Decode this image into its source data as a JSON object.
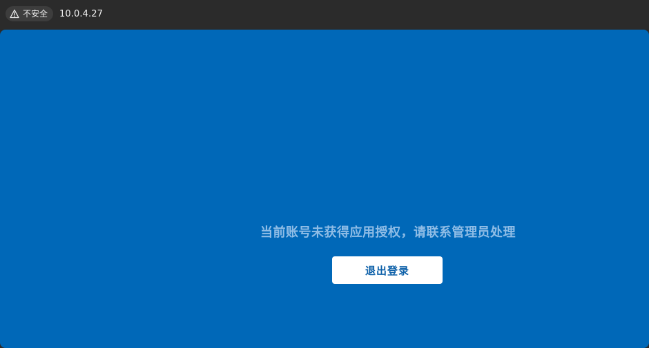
{
  "browser": {
    "security_label": "不安全",
    "security_icon": "warning-triangle-icon",
    "url": "10.0.4.27"
  },
  "page": {
    "message": "当前账号未获得应用授权，请联系管理员处理",
    "logout_label": "退出登录",
    "background_color": "#0068b8",
    "message_color": "#8fbde6",
    "button_text_color": "#0b5fa8"
  }
}
